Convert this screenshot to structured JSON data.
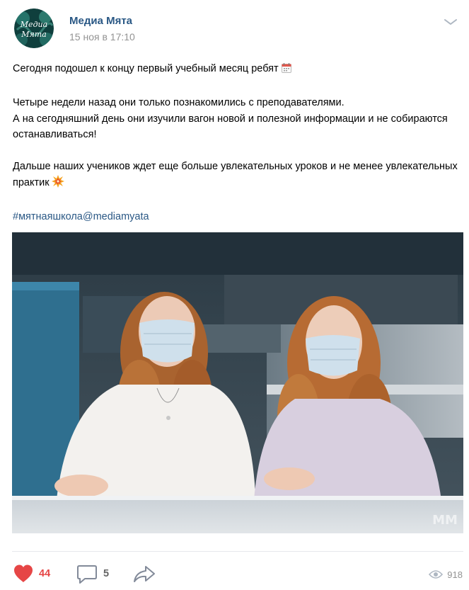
{
  "post": {
    "author": "Медиа Мята",
    "date": "15 ноя в 17:10",
    "avatar_text": [
      "Медиа",
      "Мята"
    ],
    "paragraphs": [
      "Сегодня подошел к концу первый учебный месяц ребят",
      "Четыре недели назад они только познакомились с преподавателями.",
      "А на сегодняшний день они изучили вагон новой и полезной информации и не собираются останавливаться!",
      "Дальше наших учеников ждет еще больше увлекательных уроков и не менее увлекательных практик"
    ],
    "hashtag": "#мятнаяшкола@mediamyata",
    "photo_watermark": "MM"
  },
  "footer": {
    "likes": "44",
    "comments": "5",
    "views": "918"
  },
  "colors": {
    "link": "#2a5885",
    "like": "#e64646",
    "muted": "#939393"
  },
  "icons": [
    "chevron-down-icon",
    "calendar-emoji-icon",
    "boom-emoji-icon",
    "heart-icon",
    "comment-icon",
    "share-icon",
    "eye-icon"
  ]
}
